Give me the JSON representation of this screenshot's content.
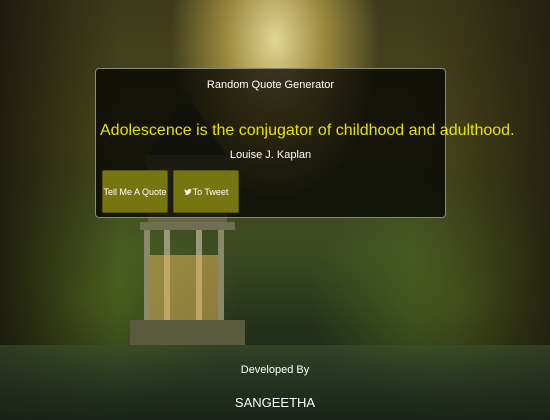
{
  "app": {
    "title": "Random Quote Generator"
  },
  "quote": {
    "text": "Adolescence is the conjugator of childhood and adulthood.",
    "author": "Louise J. Kaplan"
  },
  "buttons": {
    "new_quote_label": "Tell Me A Quote",
    "tweet_label": "To Tweet",
    "tweet_icon": "twitter-icon"
  },
  "footer": {
    "label": "Developed By",
    "name": "SANGEETHA"
  },
  "colors": {
    "quote_text": "#e8e100",
    "button_bg": "#777510",
    "box_bg": "rgba(0,0,0,0.72)"
  }
}
